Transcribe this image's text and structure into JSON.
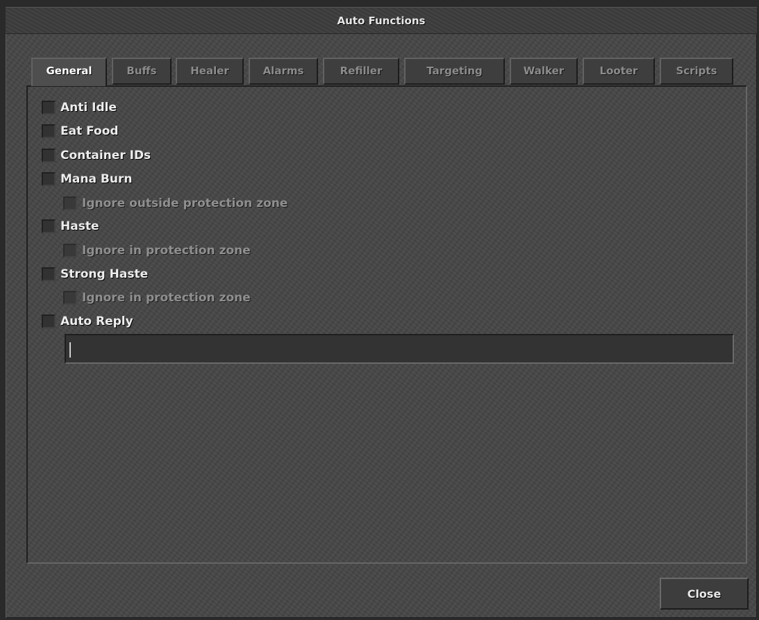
{
  "window": {
    "title": "Auto Functions"
  },
  "tabs": [
    {
      "label": "General",
      "active": true
    },
    {
      "label": "Buffs",
      "active": false
    },
    {
      "label": "Healer",
      "active": false
    },
    {
      "label": "Alarms",
      "active": false
    },
    {
      "label": "Refiller",
      "active": false
    },
    {
      "label": "Targeting",
      "active": false
    },
    {
      "label": "Walker",
      "active": false
    },
    {
      "label": "Looter",
      "active": false
    },
    {
      "label": "Scripts",
      "active": false
    }
  ],
  "options": {
    "anti_idle": {
      "label": "Anti Idle",
      "checked": false
    },
    "eat_food": {
      "label": "Eat Food",
      "checked": false
    },
    "container_ids": {
      "label": "Container IDs",
      "checked": false
    },
    "mana_burn": {
      "label": "Mana Burn",
      "checked": false
    },
    "mana_burn_ignore": {
      "label": "Ignore outside protection zone",
      "checked": false,
      "enabled": false
    },
    "haste": {
      "label": "Haste",
      "checked": false
    },
    "haste_ignore": {
      "label": "Ignore in protection zone",
      "checked": false,
      "enabled": false
    },
    "strong_haste": {
      "label": "Strong Haste",
      "checked": false
    },
    "strong_haste_ignore": {
      "label": "Ignore in protection zone",
      "checked": false,
      "enabled": false
    },
    "auto_reply": {
      "label": "Auto Reply",
      "checked": false
    }
  },
  "auto_reply_input": {
    "value": "",
    "placeholder": ""
  },
  "footer": {
    "close_label": "Close"
  },
  "colors": {
    "window_bg": "#474747",
    "text": "#ededed",
    "disabled_text": "#8f8f8f",
    "tab_inactive_text": "#8c8c8c"
  }
}
